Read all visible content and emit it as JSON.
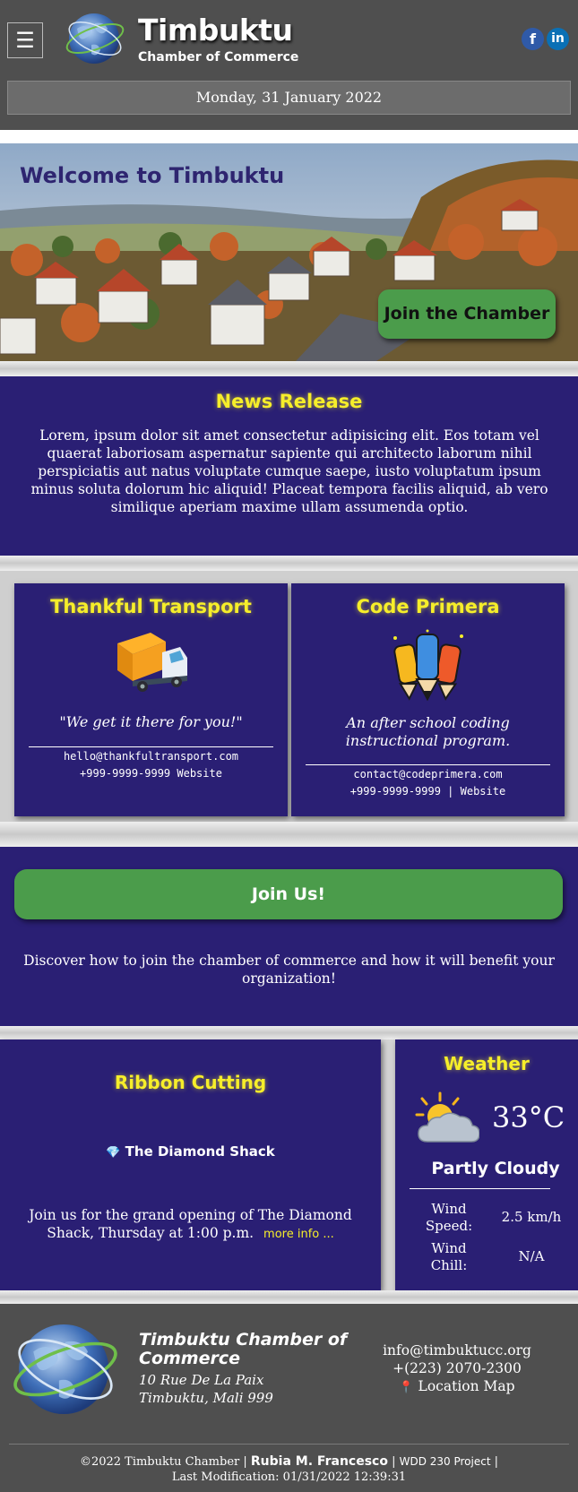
{
  "header": {
    "menu_icon": "☰",
    "brand_name": "Timbuktu",
    "brand_sub": "Chamber of Commerce",
    "social": {
      "facebook": "f",
      "linkedin": "in"
    },
    "date": "Monday, 31 January 2022"
  },
  "hero": {
    "title": "Welcome to Timbuktu",
    "cta": "Join the Chamber"
  },
  "news": {
    "heading": "News Release",
    "body": "Lorem, ipsum dolor sit amet consectetur adipisicing elit. Eos totam vel quaerat laboriosam aspernatur sapiente qui architecto laborum nihil perspiciatis aut natus voluptate cumque saepe, iusto voluptatum ipsum minus soluta dolorum hic aliquid! Placeat tempora facilis aliquid, ab vero similique aperiam maxime ullam assumenda optio."
  },
  "businesses": [
    {
      "name": "Thankful Transport",
      "tagline": "\"We get it there for you!\"",
      "email": "hello@thankfultransport.com",
      "phone_line": "+999-9999-9999 Website"
    },
    {
      "name": "Code Primera",
      "tagline": "An after school coding instructional program.",
      "email": "contact@codeprimera.com",
      "phone_line": "+999-9999-9999 | Website"
    }
  ],
  "join": {
    "button": "Join Us!",
    "text": "Discover how to join the chamber of commerce and how it will benefit your organization!"
  },
  "ribbon": {
    "heading": "Ribbon Cutting",
    "business_icon": "💎",
    "business": "The Diamond Shack",
    "text": "Join us for the grand opening of The Diamond Shack, Thursday at 1:00 p.m.",
    "more": "more info ..."
  },
  "weather": {
    "heading": "Weather",
    "temp": "33°C",
    "condition": "Partly Cloudy",
    "wind_speed_label": "Wind Speed:",
    "wind_speed": "2.5 km/h",
    "wind_chill_label": "Wind Chill:",
    "wind_chill": "N/A"
  },
  "footer": {
    "name": "Timbuktu Chamber of Commerce",
    "address1": "10 Rue De La Paix",
    "address2": "Timbuktu, Mali 999",
    "email": "info@timbuktucc.org",
    "phone": "+(223) 2070-2300",
    "map_icon": "📍",
    "map": "Location Map",
    "copyright": "©2022 Timbuktu Chamber",
    "author": "Rubia M. Francesco",
    "project": "WDD 230 Project",
    "last_mod": "Last Modification: 01/31/2022 12:39:31"
  },
  "colors": {
    "header_bg": "#4f4f4f",
    "panel_bg": "#2a1f74",
    "heading_yellow": "#f6ee2a",
    "button_green": "#4b9c4b",
    "hero_title": "#2e2570"
  }
}
